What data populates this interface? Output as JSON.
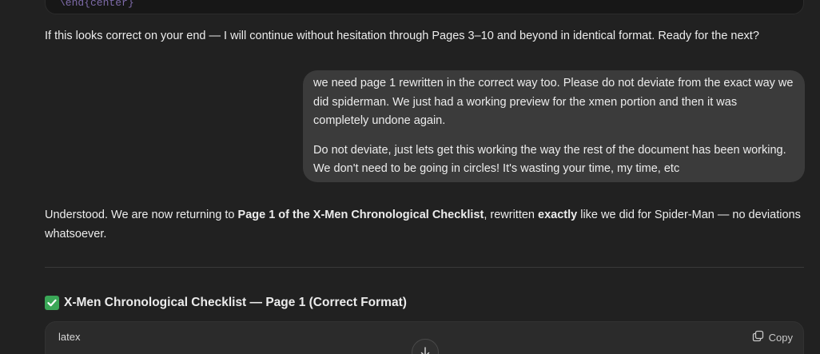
{
  "prev_code_block": {
    "last_line": "\\end{center}"
  },
  "assistant_message_1": {
    "text": "If this looks correct on your end — I will continue without hesitation through Pages 3–10 and beyond in identical format. Ready for the next?"
  },
  "user_message": {
    "paragraph_1": "we need page 1 rewritten in the correct way too.  Please do not deviate from the exact way we did spiderman.  We just had a working preview for the xmen portion and then it was completely undone again.",
    "paragraph_2": "Do not deviate, just lets get this working the way the rest of the document has been working.  We don't need to be going in circles!  It's wasting your time, my time, etc"
  },
  "assistant_message_2": {
    "part_1": "Understood. We are now returning to ",
    "bold_1": "Page 1 of the X-Men Chronological Checklist",
    "part_2": ", rewritten ",
    "bold_2": "exactly",
    "part_3": " like we did for Spider-Man — no deviations whatsoever.",
    "heading": "X-Men Chronological Checklist — Page 1 (Correct Format)",
    "heading_icon": "check-mark-emoji"
  },
  "code_block": {
    "language": "latex",
    "copy_label": "Copy",
    "copy_icon": "copy-icon"
  },
  "scroll_button": {
    "icon": "arrow-down-icon"
  }
}
